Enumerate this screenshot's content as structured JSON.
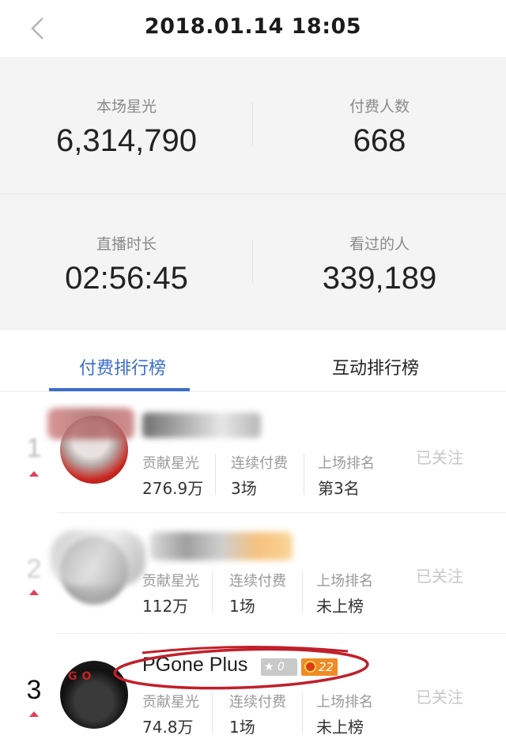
{
  "header": {
    "title": "2018.01.14 18:05"
  },
  "stats": [
    {
      "label": "本场星光",
      "value": "6,314,790"
    },
    {
      "label": "付费人数",
      "value": "668"
    },
    {
      "label": "直播时长",
      "value": "02:56:45"
    },
    {
      "label": "看过的人",
      "value": "339,189"
    }
  ],
  "tabs": [
    {
      "label": "付费排行榜",
      "active": true
    },
    {
      "label": "互动排行榜",
      "active": false
    }
  ],
  "ranking": [
    {
      "rank": "1",
      "name": "",
      "contribution_label": "贡献星光",
      "contribution": "276.9万",
      "streak_label": "连续付费",
      "streak": "3场",
      "prev_rank_label": "上场排名",
      "prev_rank": "第3名",
      "follow": "已关注"
    },
    {
      "rank": "2",
      "name": "",
      "contribution_label": "贡献星光",
      "contribution": "112万",
      "streak_label": "连续付费",
      "streak": "1场",
      "prev_rank_label": "上场排名",
      "prev_rank": "未上榜",
      "follow": "已关注"
    },
    {
      "rank": "3",
      "name": "PGone Plus",
      "star_badge": "0",
      "level_badge": "22",
      "contribution_label": "贡献星光",
      "contribution": "74.8万",
      "streak_label": "连续付费",
      "streak": "1场",
      "prev_rank_label": "上场排名",
      "prev_rank": "未上榜",
      "follow": "已关注"
    }
  ],
  "colors": {
    "accent": "#3a6dcc",
    "rank_arrow": "#e0405a",
    "level_badge": "#f08a25",
    "annotation": "#c0202a"
  }
}
